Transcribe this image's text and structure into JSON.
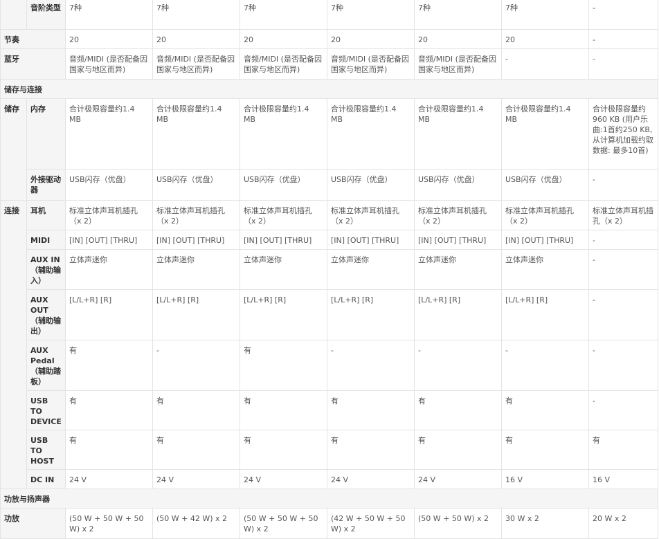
{
  "rows": {
    "scale_type": {
      "label": "音阶类型",
      "values": [
        "7种",
        "7种",
        "7种",
        "7种",
        "7种",
        "7种",
        "-"
      ]
    },
    "rhythm": {
      "label": "节奏",
      "values": [
        "20",
        "20",
        "20",
        "20",
        "20",
        "20",
        "-"
      ]
    },
    "bluetooth": {
      "label": "蓝牙",
      "values": [
        "音频/MIDI (是否配备因国家与地区而异)",
        "音频/MIDI (是否配备因国家与地区而异)",
        "音频/MIDI (是否配备因国家与地区而异)",
        "音频/MIDI (是否配备因国家与地区而异)",
        "音频/MIDI (是否配备因国家与地区而异)",
        "-",
        "-"
      ]
    },
    "section_storage": {
      "label": "储存与连接"
    },
    "storage": {
      "label": "储存",
      "memory": {
        "label": "内存",
        "values": [
          "合计极限容量约1.4 MB",
          "合计极限容量约1.4 MB",
          "合计极限容量约1.4 MB",
          "合计极限容量约1.4 MB",
          "合计极限容量约1.4 MB",
          "合计极限容量约1.4 MB",
          "合计极限容量约960 KB (用户乐曲:1首约250 KB, 从计算机加载约取数据: 最多10首)"
        ]
      },
      "ext_drive": {
        "label": "外接驱动器",
        "values": [
          "USB闪存（优盘）",
          "USB闪存（优盘）",
          "USB闪存（优盘）",
          "USB闪存（优盘）",
          "USB闪存（优盘）",
          "USB闪存（优盘）",
          "-"
        ]
      }
    },
    "connection": {
      "label": "连接",
      "headphones": {
        "label": "耳机",
        "values": [
          "标准立体声耳机插孔（x 2）",
          "标准立体声耳机插孔（x 2）",
          "标准立体声耳机插孔（x 2）",
          "标准立体声耳机插孔（x 2）",
          "标准立体声耳机插孔（x 2）",
          "标准立体声耳机插孔（x 2）",
          "标准立体声耳机插孔（x 2）"
        ]
      },
      "midi": {
        "label": "MIDI",
        "values": [
          "[IN] [OUT] [THRU]",
          "[IN] [OUT] [THRU]",
          "[IN] [OUT] [THRU]",
          "[IN] [OUT] [THRU]",
          "[IN] [OUT] [THRU]",
          "[IN] [OUT] [THRU]",
          "-"
        ]
      },
      "aux_in": {
        "label": "AUX IN（辅助输入）",
        "values": [
          "立体声迷你",
          "立体声迷你",
          "立体声迷你",
          "立体声迷你",
          "立体声迷你",
          "立体声迷你",
          "-"
        ]
      },
      "aux_out": {
        "label": "AUX OUT（辅助输出）",
        "values": [
          "[L/L+R] [R]",
          "[L/L+R] [R]",
          "[L/L+R] [R]",
          "[L/L+R] [R]",
          "[L/L+R] [R]",
          "[L/L+R] [R]",
          "-"
        ]
      },
      "aux_pedal": {
        "label": "AUX Pedal（辅助踏板）",
        "values": [
          "有",
          "-",
          "有",
          "-",
          "-",
          "-",
          "-"
        ]
      },
      "usb_to_device": {
        "label": "USB TO DEVICE",
        "values": [
          "有",
          "有",
          "有",
          "有",
          "有",
          "有",
          "-"
        ]
      },
      "usb_to_host": {
        "label": "USB TO HOST",
        "values": [
          "有",
          "有",
          "有",
          "有",
          "有",
          "有",
          "有"
        ]
      },
      "dc_in": {
        "label": "DC IN",
        "values": [
          "24 V",
          "24 V",
          "24 V",
          "24 V",
          "24 V",
          "16 V",
          "16 V"
        ]
      }
    },
    "section_amp": {
      "label": "功放与扬声器"
    },
    "amplifier": {
      "label": "功放",
      "values": [
        "(50 W + 50 W + 50 W) x 2",
        "(50 W + 42 W) x 2",
        "(50 W + 50 W + 50 W) x 2",
        "(42 W + 50 W + 50 W) x 2",
        "(50 W + 50 W) x 2",
        "30 W x 2",
        "20 W x 2"
      ]
    }
  }
}
